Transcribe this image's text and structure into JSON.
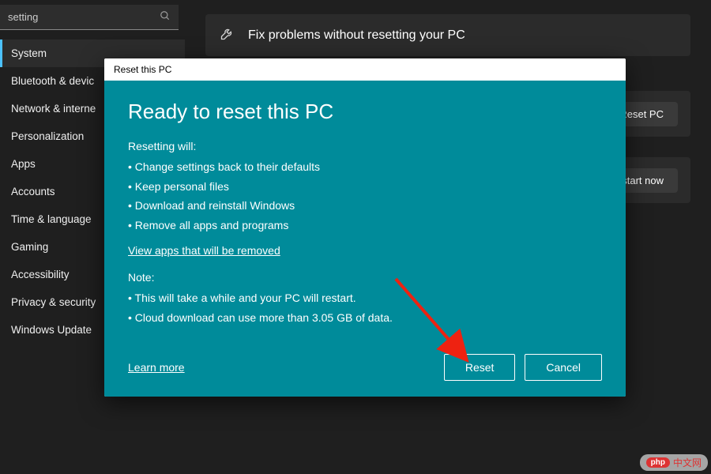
{
  "search": {
    "placeholder": "setting"
  },
  "sidebar": {
    "items": [
      {
        "label": "System"
      },
      {
        "label": "Bluetooth & devic"
      },
      {
        "label": "Network & interne"
      },
      {
        "label": "Personalization"
      },
      {
        "label": "Apps"
      },
      {
        "label": "Accounts"
      },
      {
        "label": "Time & language"
      },
      {
        "label": "Gaming"
      },
      {
        "label": "Accessibility"
      },
      {
        "label": "Privacy & security"
      },
      {
        "label": "Windows Update"
      }
    ]
  },
  "content": {
    "fix_tile": "Fix problems without resetting your PC",
    "reset_btn": "Reset PC",
    "restart_btn": "Restart now"
  },
  "modal": {
    "title": "Reset this PC",
    "heading": "Ready to reset this PC",
    "resetting_label": "Resetting will:",
    "reset_items": [
      "Change settings back to their defaults",
      "Keep personal files",
      "Download and reinstall Windows",
      "Remove all apps and programs"
    ],
    "view_apps": "View apps that will be removed",
    "note_label": "Note:",
    "note_items": [
      "This will take a while and your PC will restart.",
      "Cloud download can use more than 3.05 GB of data."
    ],
    "learn_more": "Learn more",
    "reset_button": "Reset",
    "cancel_button": "Cancel"
  },
  "watermark": {
    "brand": "php",
    "text": "中文网"
  }
}
